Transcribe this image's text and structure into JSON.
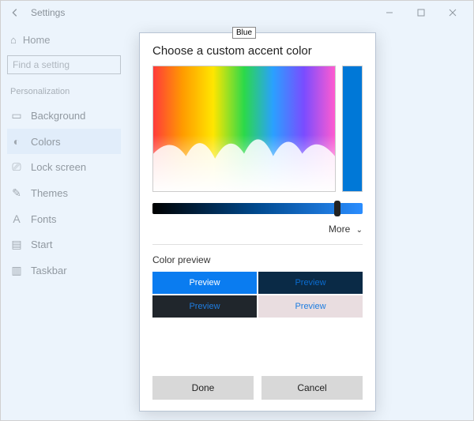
{
  "window": {
    "title": "Settings"
  },
  "home_label": "Home",
  "search": {
    "placeholder": "Find a setting"
  },
  "section_label": "Personalization",
  "nav": [
    {
      "icon": "▭",
      "label": "Background"
    },
    {
      "icon": "◐",
      "label": "Colors"
    },
    {
      "icon": "⎚",
      "label": "Lock screen"
    },
    {
      "icon": "✎",
      "label": "Themes"
    },
    {
      "icon": "A",
      "label": "Fonts"
    },
    {
      "icon": "▤",
      "label": "Start"
    },
    {
      "icon": "▥",
      "label": "Taskbar"
    }
  ],
  "dialog": {
    "title": "Choose a custom accent color",
    "tooltip": "Blue",
    "selected_color": "#0078d7",
    "more_label": "More",
    "preview_head": "Color preview",
    "preview_label": "Preview",
    "done": "Done",
    "cancel": "Cancel"
  }
}
